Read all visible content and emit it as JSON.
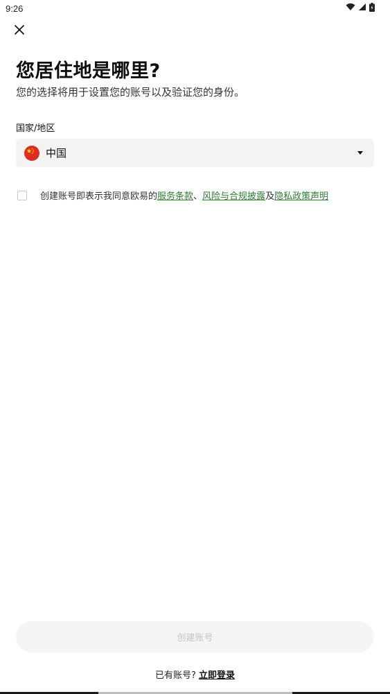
{
  "status_bar": {
    "time": "9:26",
    "icons": [
      "wifi-icon",
      "signal-icon",
      "battery-icon"
    ]
  },
  "header": {
    "close_icon": "close-icon",
    "title": "您居住地是哪里?",
    "subtitle": "您的选择将用于设置您的账号以及验证您的身份。"
  },
  "country": {
    "label": "国家/地区",
    "selected": "中国",
    "flag_icon": "china-flag-icon",
    "dropdown_icon": "caret-down-icon"
  },
  "terms": {
    "checked": false,
    "prefix": "创建账号即表示我同意欧易的",
    "link1": "服务条款",
    "sep1": "、",
    "link2": "风险与合规披露",
    "sep2": "及",
    "link3": "隐私政策声明",
    "link_color": "#2e7d32"
  },
  "actions": {
    "create_label": "创建账号",
    "login_prompt": "已有账号?",
    "login_link": "立即登录"
  }
}
